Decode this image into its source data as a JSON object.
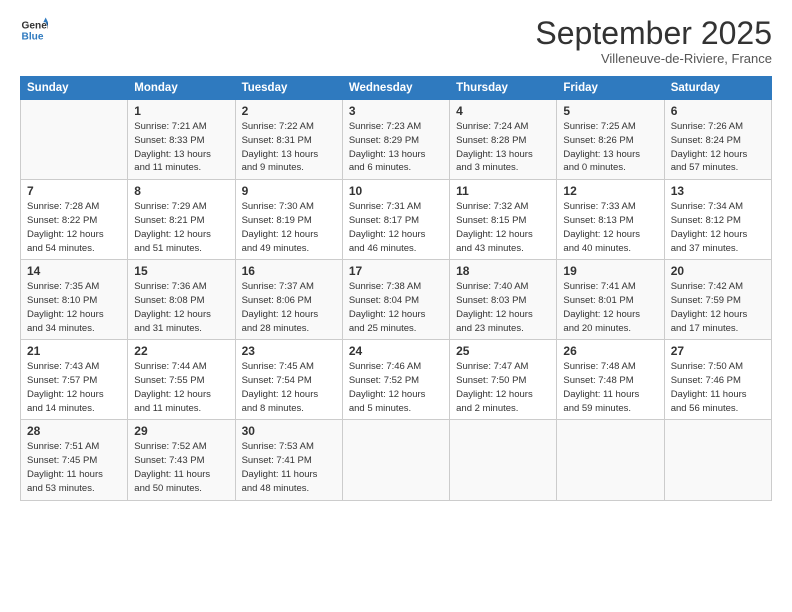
{
  "logo": {
    "line1": "General",
    "line2": "Blue"
  },
  "header": {
    "month": "September 2025",
    "location": "Villeneuve-de-Riviere, France"
  },
  "days_of_week": [
    "Sunday",
    "Monday",
    "Tuesday",
    "Wednesday",
    "Thursday",
    "Friday",
    "Saturday"
  ],
  "weeks": [
    [
      {
        "day": "",
        "info": ""
      },
      {
        "day": "1",
        "info": "Sunrise: 7:21 AM\nSunset: 8:33 PM\nDaylight: 13 hours\nand 11 minutes."
      },
      {
        "day": "2",
        "info": "Sunrise: 7:22 AM\nSunset: 8:31 PM\nDaylight: 13 hours\nand 9 minutes."
      },
      {
        "day": "3",
        "info": "Sunrise: 7:23 AM\nSunset: 8:29 PM\nDaylight: 13 hours\nand 6 minutes."
      },
      {
        "day": "4",
        "info": "Sunrise: 7:24 AM\nSunset: 8:28 PM\nDaylight: 13 hours\nand 3 minutes."
      },
      {
        "day": "5",
        "info": "Sunrise: 7:25 AM\nSunset: 8:26 PM\nDaylight: 13 hours\nand 0 minutes."
      },
      {
        "day": "6",
        "info": "Sunrise: 7:26 AM\nSunset: 8:24 PM\nDaylight: 12 hours\nand 57 minutes."
      }
    ],
    [
      {
        "day": "7",
        "info": "Sunrise: 7:28 AM\nSunset: 8:22 PM\nDaylight: 12 hours\nand 54 minutes."
      },
      {
        "day": "8",
        "info": "Sunrise: 7:29 AM\nSunset: 8:21 PM\nDaylight: 12 hours\nand 51 minutes."
      },
      {
        "day": "9",
        "info": "Sunrise: 7:30 AM\nSunset: 8:19 PM\nDaylight: 12 hours\nand 49 minutes."
      },
      {
        "day": "10",
        "info": "Sunrise: 7:31 AM\nSunset: 8:17 PM\nDaylight: 12 hours\nand 46 minutes."
      },
      {
        "day": "11",
        "info": "Sunrise: 7:32 AM\nSunset: 8:15 PM\nDaylight: 12 hours\nand 43 minutes."
      },
      {
        "day": "12",
        "info": "Sunrise: 7:33 AM\nSunset: 8:13 PM\nDaylight: 12 hours\nand 40 minutes."
      },
      {
        "day": "13",
        "info": "Sunrise: 7:34 AM\nSunset: 8:12 PM\nDaylight: 12 hours\nand 37 minutes."
      }
    ],
    [
      {
        "day": "14",
        "info": "Sunrise: 7:35 AM\nSunset: 8:10 PM\nDaylight: 12 hours\nand 34 minutes."
      },
      {
        "day": "15",
        "info": "Sunrise: 7:36 AM\nSunset: 8:08 PM\nDaylight: 12 hours\nand 31 minutes."
      },
      {
        "day": "16",
        "info": "Sunrise: 7:37 AM\nSunset: 8:06 PM\nDaylight: 12 hours\nand 28 minutes."
      },
      {
        "day": "17",
        "info": "Sunrise: 7:38 AM\nSunset: 8:04 PM\nDaylight: 12 hours\nand 25 minutes."
      },
      {
        "day": "18",
        "info": "Sunrise: 7:40 AM\nSunset: 8:03 PM\nDaylight: 12 hours\nand 23 minutes."
      },
      {
        "day": "19",
        "info": "Sunrise: 7:41 AM\nSunset: 8:01 PM\nDaylight: 12 hours\nand 20 minutes."
      },
      {
        "day": "20",
        "info": "Sunrise: 7:42 AM\nSunset: 7:59 PM\nDaylight: 12 hours\nand 17 minutes."
      }
    ],
    [
      {
        "day": "21",
        "info": "Sunrise: 7:43 AM\nSunset: 7:57 PM\nDaylight: 12 hours\nand 14 minutes."
      },
      {
        "day": "22",
        "info": "Sunrise: 7:44 AM\nSunset: 7:55 PM\nDaylight: 12 hours\nand 11 minutes."
      },
      {
        "day": "23",
        "info": "Sunrise: 7:45 AM\nSunset: 7:54 PM\nDaylight: 12 hours\nand 8 minutes."
      },
      {
        "day": "24",
        "info": "Sunrise: 7:46 AM\nSunset: 7:52 PM\nDaylight: 12 hours\nand 5 minutes."
      },
      {
        "day": "25",
        "info": "Sunrise: 7:47 AM\nSunset: 7:50 PM\nDaylight: 12 hours\nand 2 minutes."
      },
      {
        "day": "26",
        "info": "Sunrise: 7:48 AM\nSunset: 7:48 PM\nDaylight: 11 hours\nand 59 minutes."
      },
      {
        "day": "27",
        "info": "Sunrise: 7:50 AM\nSunset: 7:46 PM\nDaylight: 11 hours\nand 56 minutes."
      }
    ],
    [
      {
        "day": "28",
        "info": "Sunrise: 7:51 AM\nSunset: 7:45 PM\nDaylight: 11 hours\nand 53 minutes."
      },
      {
        "day": "29",
        "info": "Sunrise: 7:52 AM\nSunset: 7:43 PM\nDaylight: 11 hours\nand 50 minutes."
      },
      {
        "day": "30",
        "info": "Sunrise: 7:53 AM\nSunset: 7:41 PM\nDaylight: 11 hours\nand 48 minutes."
      },
      {
        "day": "",
        "info": ""
      },
      {
        "day": "",
        "info": ""
      },
      {
        "day": "",
        "info": ""
      },
      {
        "day": "",
        "info": ""
      }
    ]
  ]
}
